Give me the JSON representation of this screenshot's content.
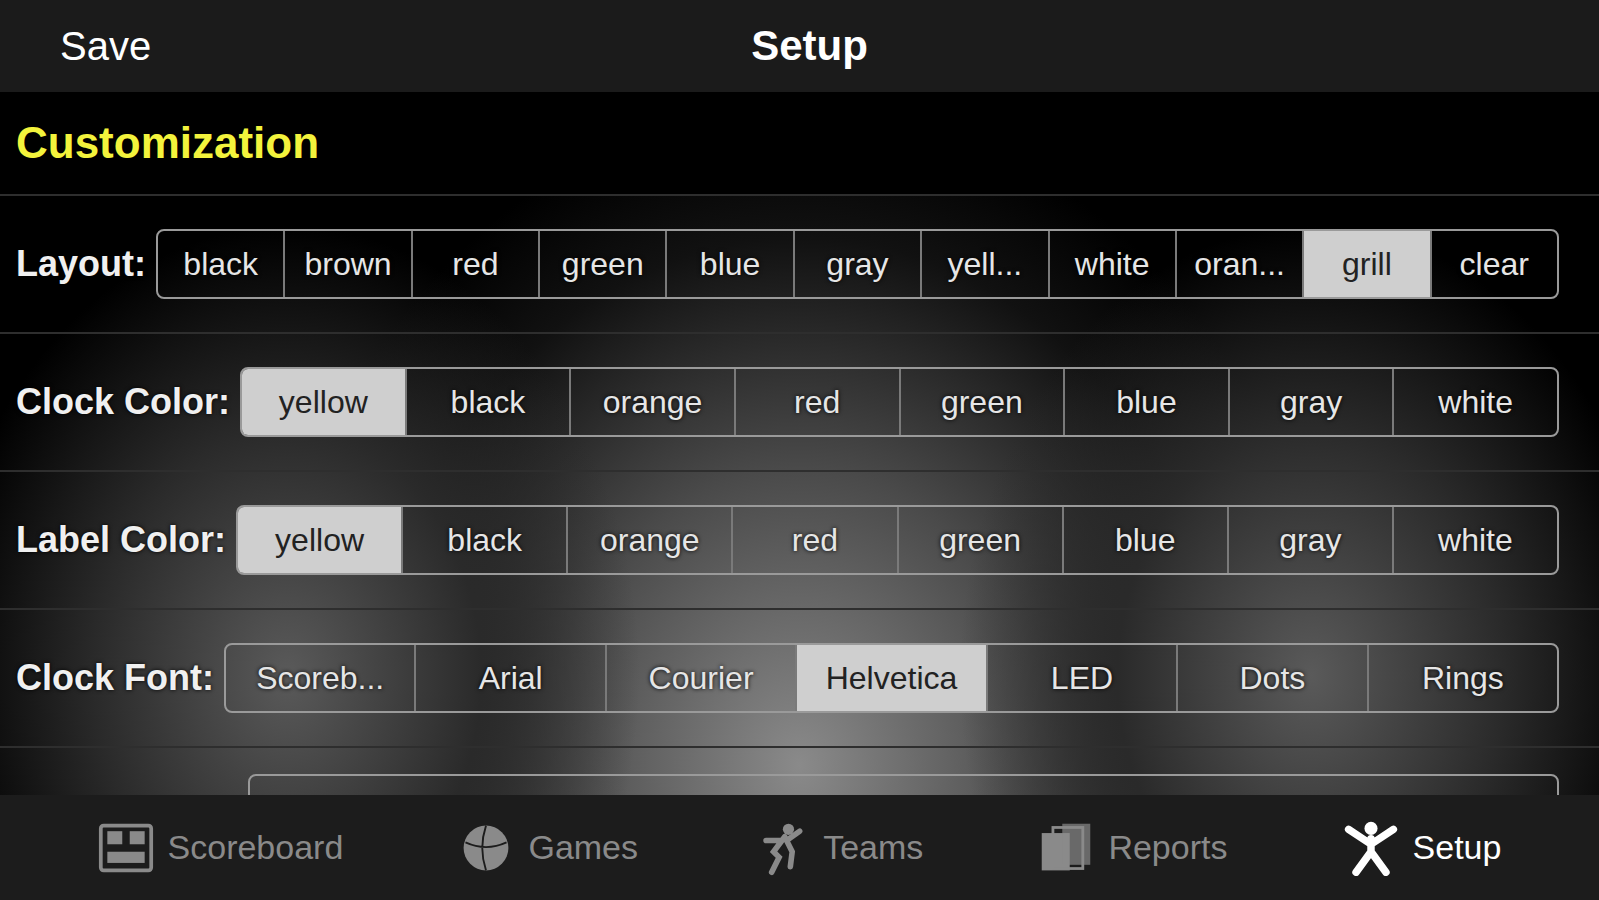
{
  "window": {
    "title": "Setup"
  },
  "header": {
    "save": "Save"
  },
  "section": {
    "title": "Customization"
  },
  "settings": [
    {
      "label": "Layout:",
      "options": [
        {
          "label": "black",
          "selected": false
        },
        {
          "label": "brown",
          "selected": false
        },
        {
          "label": "red",
          "selected": false
        },
        {
          "label": "green",
          "selected": false
        },
        {
          "label": "blue",
          "selected": false
        },
        {
          "label": "gray",
          "selected": false
        },
        {
          "label": "yell...",
          "selected": false
        },
        {
          "label": "white",
          "selected": false
        },
        {
          "label": "oran...",
          "selected": false
        },
        {
          "label": "grill",
          "selected": true
        },
        {
          "label": "clear",
          "selected": false
        }
      ]
    },
    {
      "label": "Clock Color:",
      "options": [
        {
          "label": "yellow",
          "selected": true
        },
        {
          "label": "black",
          "selected": false
        },
        {
          "label": "orange",
          "selected": false
        },
        {
          "label": "red",
          "selected": false
        },
        {
          "label": "green",
          "selected": false
        },
        {
          "label": "blue",
          "selected": false
        },
        {
          "label": "gray",
          "selected": false
        },
        {
          "label": "white",
          "selected": false
        }
      ]
    },
    {
      "label": "Label Color:",
      "options": [
        {
          "label": "yellow",
          "selected": true
        },
        {
          "label": "black",
          "selected": false
        },
        {
          "label": "orange",
          "selected": false
        },
        {
          "label": "red",
          "selected": false
        },
        {
          "label": "green",
          "selected": false
        },
        {
          "label": "blue",
          "selected": false
        },
        {
          "label": "gray",
          "selected": false
        },
        {
          "label": "white",
          "selected": false
        }
      ]
    },
    {
      "label": "Clock Font:",
      "options": [
        {
          "label": "Scoreb...",
          "selected": false
        },
        {
          "label": "Arial",
          "selected": false
        },
        {
          "label": "Courier",
          "selected": false
        },
        {
          "label": "Helvetica",
          "selected": true
        },
        {
          "label": "LED",
          "selected": false
        },
        {
          "label": "Dots",
          "selected": false
        },
        {
          "label": "Rings",
          "selected": false
        }
      ]
    }
  ],
  "tabs": [
    {
      "label": "Scoreboard",
      "selected": false,
      "kind": "scoreboard"
    },
    {
      "label": "Games",
      "selected": false,
      "kind": "games"
    },
    {
      "label": "Teams",
      "selected": false,
      "kind": "teams"
    },
    {
      "label": "Reports",
      "selected": false,
      "kind": "reports"
    },
    {
      "label": "Setup",
      "selected": true,
      "kind": "setup"
    }
  ]
}
